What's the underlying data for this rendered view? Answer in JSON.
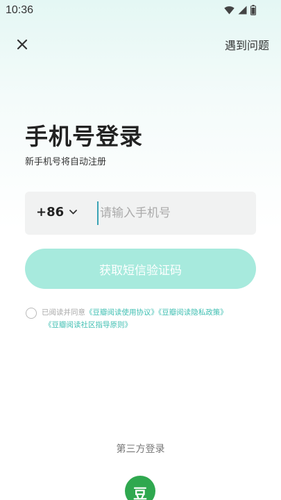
{
  "status_bar": {
    "time": "10:36",
    "icons": [
      "wifi-icon",
      "cellular-signal-icon",
      "battery-icon"
    ]
  },
  "header": {
    "close_icon": "close-icon",
    "help_label": "遇到问题"
  },
  "login": {
    "title": "手机号登录",
    "subtitle": "新手机号将自动注册",
    "country_code": "+86",
    "phone_placeholder": "请输入手机号",
    "phone_value": "",
    "sms_button_label": "获取短信验证码"
  },
  "agreement": {
    "prefix": "已阅读并同意",
    "user_agreement": "《豆瓣阅读使用协议》",
    "privacy_policy": "《豆瓣阅读隐私政策》",
    "community_guidelines": "《豆瓣阅读社区指导原则》",
    "checked": false
  },
  "third_party": {
    "label": "第三方登录",
    "douban_glyph": "豆"
  },
  "colors": {
    "accent": "#a7eadd",
    "link": "#3fbfb2",
    "douban_green": "#2fa84f"
  }
}
